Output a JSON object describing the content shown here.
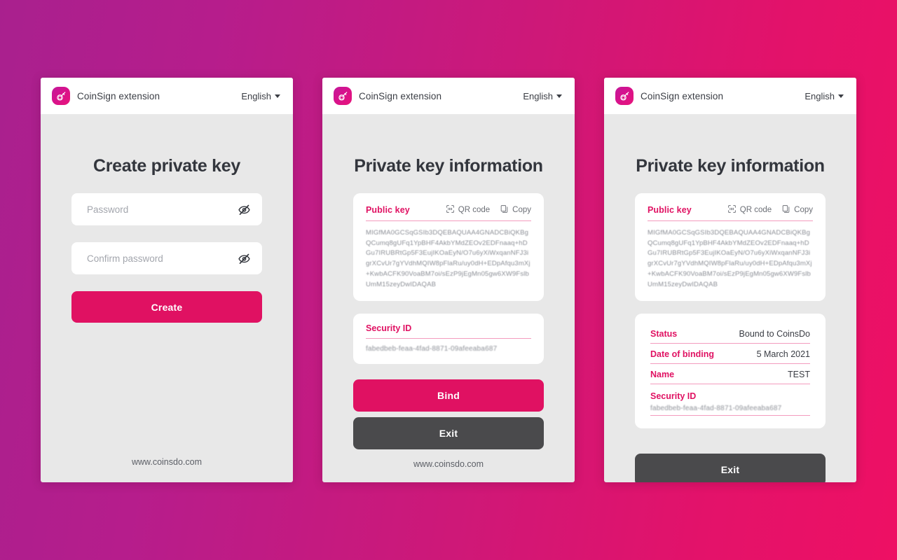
{
  "theme": {
    "accent": "#E01162",
    "accent_underline": "#F39BBE",
    "dark_button": "#4a4a4c",
    "heading": "#33363d",
    "card_bg": "#e8e8e8",
    "background_left": "#A9208E",
    "background_right": "#EE1064"
  },
  "header": {
    "brand": "CoinSign extension",
    "language": "English",
    "logo_icon": "coinsign-logo-icon",
    "caret_icon": "chevron-down-icon"
  },
  "footer": {
    "url": "www.coinsdo.com"
  },
  "shared": {
    "public_key_label": "Public key",
    "qr_code_label": "QR code",
    "copy_label": "Copy",
    "qr_icon": "qr-code-icon",
    "copy_icon": "copy-icon",
    "public_key_value": "MIGfMA0GCSqGSIb3DQEBAQUAA4GNADCBiQKBgQCumq8gUFq1YpBHF4AkbYMdZEOv2EDFnaaq+hDGu7IRUBRtGp5F3EujIKOaEyN/O7u6yXiWxqanNFJ3igrXCvUr7gYVdhMQIW8pFlaRu/uy0dH+EDpAfqu3mXj+KwbACFK90VoaBM7oi/sEzP9jEgMn05gw6XW9FslbUmM15zeyDwIDAQAB",
    "security_id_label": "Security ID",
    "security_id_value": "fabedbeb-feaa-4fad-8871-09afeeaba687",
    "exit_label": "Exit"
  },
  "cards": [
    {
      "id": "create-private-key",
      "title": "Create private key",
      "password_placeholder": "Password",
      "password_value": "",
      "confirm_placeholder": "Confirm password",
      "confirm_value": "",
      "toggle_icon": "eye-slash-icon",
      "create_label": "Create"
    },
    {
      "id": "private-key-information-unbound",
      "title": "Private key information",
      "bind_label": "Bind"
    },
    {
      "id": "private-key-information-bound",
      "title": "Private key information",
      "details": [
        {
          "key": "Status",
          "value": "Bound to CoinsDo"
        },
        {
          "key": "Date of binding",
          "value": "5 March 2021"
        },
        {
          "key": "Name",
          "value": "TEST"
        }
      ]
    }
  ]
}
